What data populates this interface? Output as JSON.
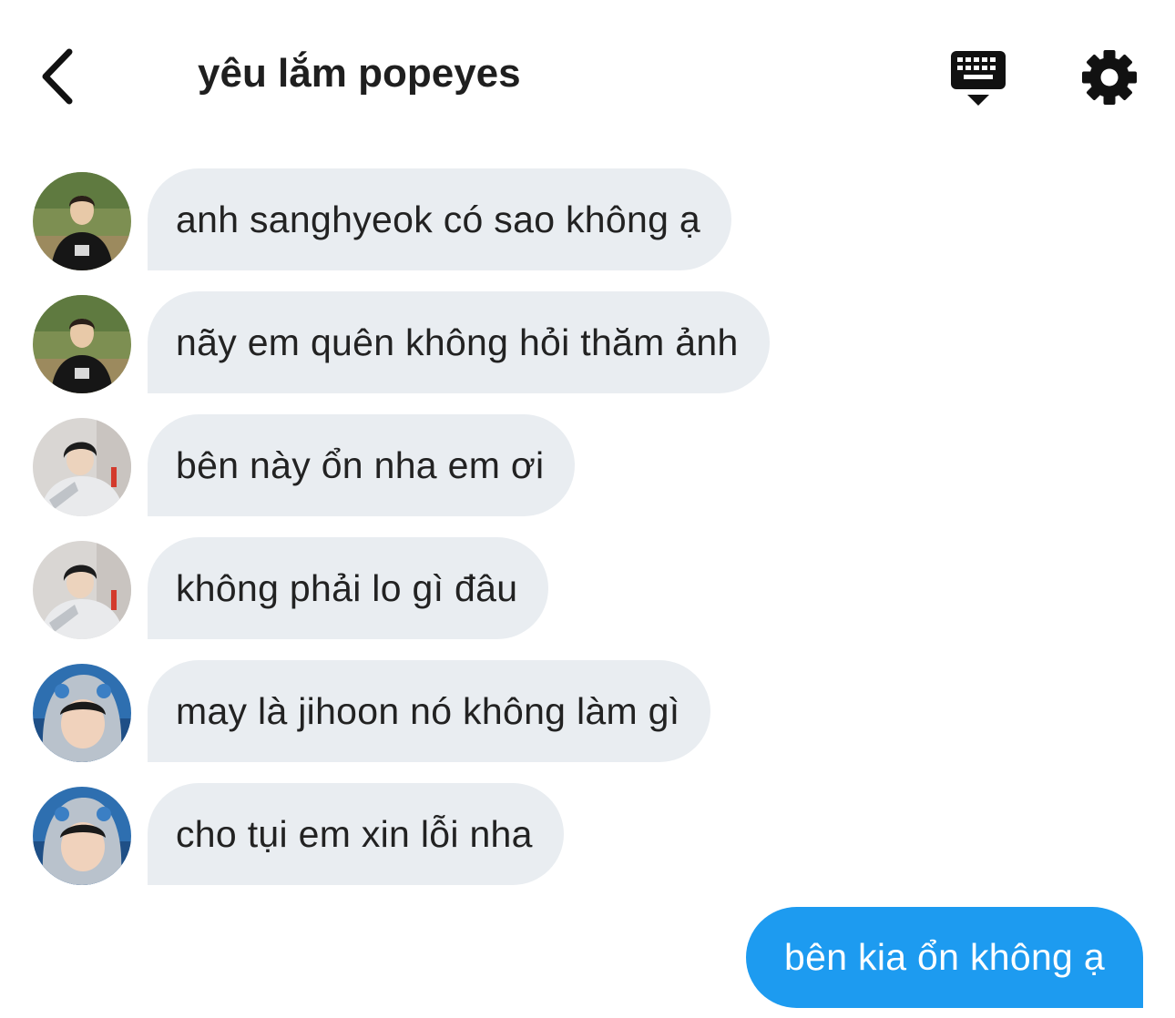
{
  "header": {
    "title": "yêu lắm popeyes",
    "back_icon": "chevron-left-icon",
    "keyboard_icon": "keyboard-icon",
    "settings_icon": "gear-icon"
  },
  "messages": [
    {
      "text": "anh sanghyeok có sao không ạ",
      "avatar": "avatar-green-jersey"
    },
    {
      "text": "nãy em quên không hỏi thăm ảnh",
      "avatar": "avatar-green-jersey"
    },
    {
      "text": "bên này ổn nha em ơi",
      "avatar": "avatar-grey-jacket"
    },
    {
      "text": "không phải lo gì đâu",
      "avatar": "avatar-grey-jacket"
    },
    {
      "text": "may là jihoon nó không làm gì",
      "avatar": "avatar-hooded"
    },
    {
      "text": "cho tụi em xin lỗi nha",
      "avatar": "avatar-hooded"
    }
  ],
  "outgoing": {
    "text": "bên kia ổn không ạ"
  },
  "colors": {
    "incoming_bubble": "#e9edf1",
    "outgoing_bubble": "#1d9bf0",
    "text": "#222222"
  }
}
